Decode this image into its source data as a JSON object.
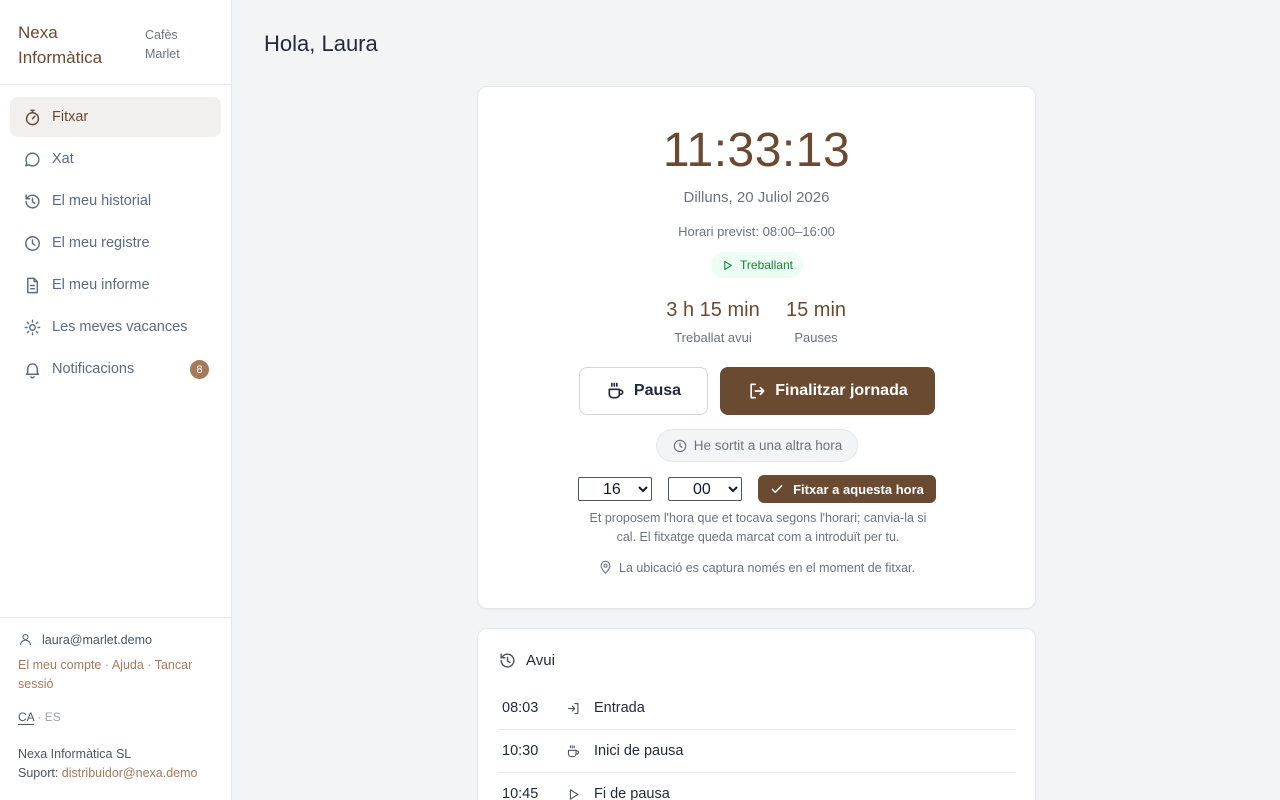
{
  "brand": {
    "name": "Nexa Informàtica",
    "client": "Cafès Marlet"
  },
  "nav": {
    "items": [
      {
        "label": "Fitxar",
        "icon": "stopwatch-icon",
        "active": true
      },
      {
        "label": "Xat",
        "icon": "chat-bubble-icon"
      },
      {
        "label": "El meu historial",
        "icon": "history-icon"
      },
      {
        "label": "El meu registre",
        "icon": "clock-icon"
      },
      {
        "label": "El meu informe",
        "icon": "document-icon"
      },
      {
        "label": "Les meves vacances",
        "icon": "sun-icon"
      },
      {
        "label": "Notificacions",
        "icon": "bell-icon",
        "badge": "8"
      }
    ]
  },
  "footer": {
    "email": "laura@marlet.demo",
    "account": "El meu compte",
    "help": "Ajuda",
    "logout": "Tancar sessió",
    "lang_ca": "CA",
    "lang_es": "ES",
    "company": "Nexa Informàtica SL",
    "support_label": "Suport:",
    "support_email": "distribuidor@nexa.demo"
  },
  "main": {
    "greeting": "Hola, Laura",
    "clock": {
      "time": "11:33:13",
      "date": "Dilluns, 20 Juliol 2026",
      "schedule": "Horari previst: 08:00–16:00",
      "status": "Treballant",
      "worked_value": "3 h 15 min",
      "worked_label": "Treballat avui",
      "pauses_value": "15 min",
      "pauses_label": "Pauses",
      "pause_button": "Pausa",
      "end_button": "Finalitzar jornada",
      "other_time_button": "He sortit a una altra hora",
      "hour_selected": "16",
      "minute_selected": "00",
      "clockin_button": "Fitxar a aquesta hora",
      "hint": "Et proposem l'hora que et tocava segons l'horari; canvia-la si cal. El fitxatge queda marcat com a introduït per tu.",
      "location_note": "La ubicació es captura només en el moment de fitxar."
    },
    "today": {
      "title": "Avui",
      "events": [
        {
          "time": "08:03",
          "label": "Entrada",
          "icon": "login-icon"
        },
        {
          "time": "10:30",
          "label": "Inici de pausa",
          "icon": "coffee-icon"
        },
        {
          "time": "10:45",
          "label": "Fi de pausa",
          "icon": "play-icon"
        }
      ]
    }
  },
  "colors": {
    "brand": "#6b4a32",
    "accent": "#a47a5a",
    "working": "#15803d"
  }
}
